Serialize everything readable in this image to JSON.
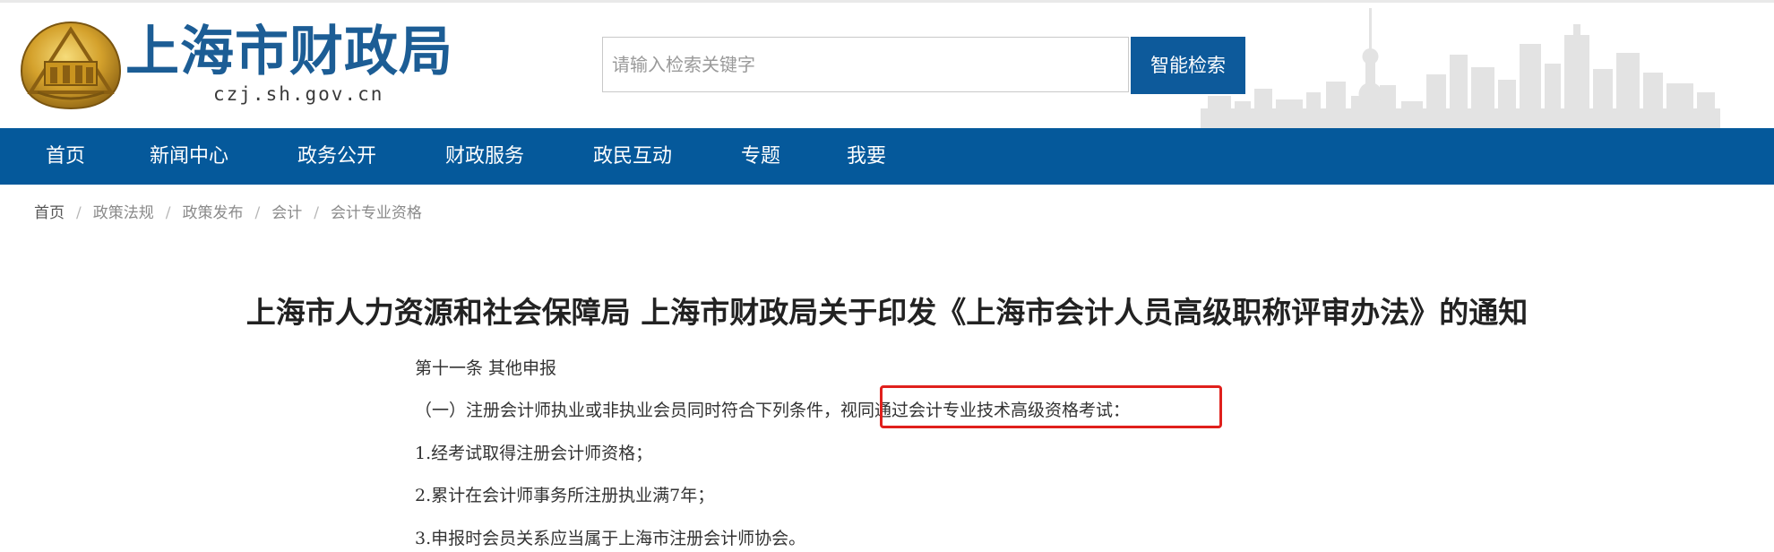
{
  "header": {
    "site_title": "上海市财政局",
    "site_domain": "czj.sh.gov.cn",
    "search": {
      "placeholder": "请输入检索关键字",
      "value": ""
    },
    "search_button": "智能检索"
  },
  "nav": {
    "items": [
      "首页",
      "新闻中心",
      "政务公开",
      "财政服务",
      "政民互动",
      "专题",
      "我要"
    ]
  },
  "breadcrumb": {
    "items": [
      "首页",
      "政策法规",
      "政策发布",
      "会计",
      "会计专业资格"
    ],
    "separator": "/"
  },
  "article": {
    "title": "上海市人力资源和社会保障局 上海市财政局关于印发《上海市会计人员高级职称评审办法》的通知",
    "paragraphs": [
      "第十一条 其他申报",
      "（一）注册会计师执业或非执业会员同时符合下列条件，视同通过会计专业技术高级资格考试：",
      "1.经考试取得注册会计师资格；",
      "2.累计在会计师事务所注册执业满7年；",
      "3.申报时会员关系应当属于上海市注册会计师协会。"
    ],
    "highlighted_text": "视同通过会计专业技术高级资格考试："
  },
  "colors": {
    "nav_bg": "#05599b",
    "search_button_bg": "#0d5a9b",
    "title_blue": "#1c5d95",
    "highlight_red": "#e0201c"
  }
}
